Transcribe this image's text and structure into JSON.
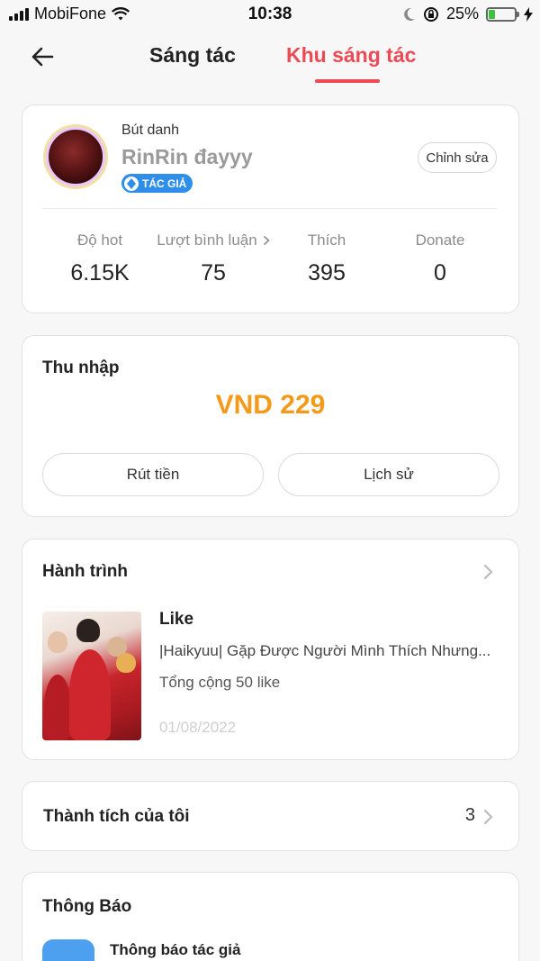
{
  "status_bar": {
    "carrier": "MobiFone",
    "time": "10:38",
    "battery_percent": "25%",
    "battery_level": 0.25,
    "battery_color": "#3cc23c"
  },
  "nav": {
    "back_icon": "arrow-left-icon",
    "tab_create": "Sáng tác",
    "tab_area": "Khu sáng tác",
    "active_color": "#ee4a55"
  },
  "profile": {
    "pen_label": "Bút danh",
    "pen_name": "RinRin đayyy",
    "badge": "TÁC GIẢ",
    "edit_button": "Chỉnh sửa",
    "stats": [
      {
        "label": "Độ hot",
        "value": "6.15K"
      },
      {
        "label": "Lượt bình luận",
        "value": "75"
      },
      {
        "label": "Thích",
        "value": "395"
      },
      {
        "label": "Donate",
        "value": "0"
      }
    ]
  },
  "income": {
    "title": "Thu nhập",
    "amount": "VND 229",
    "amount_color": "#f39a1a",
    "withdraw_button": "Rút tiền",
    "history_button": "Lịch sử"
  },
  "journey": {
    "title": "Hành trình",
    "type": "Like",
    "book_title": "|Haikyuu| Gặp Được Người Mình Thích Nhưng...",
    "total": "Tổng cộng 50 like",
    "date": "01/08/2022"
  },
  "achievements": {
    "title": "Thành tích của tôi",
    "count": "3"
  },
  "notices": {
    "title": "Thông Báo",
    "first_item": "Thông báo tác giả"
  }
}
